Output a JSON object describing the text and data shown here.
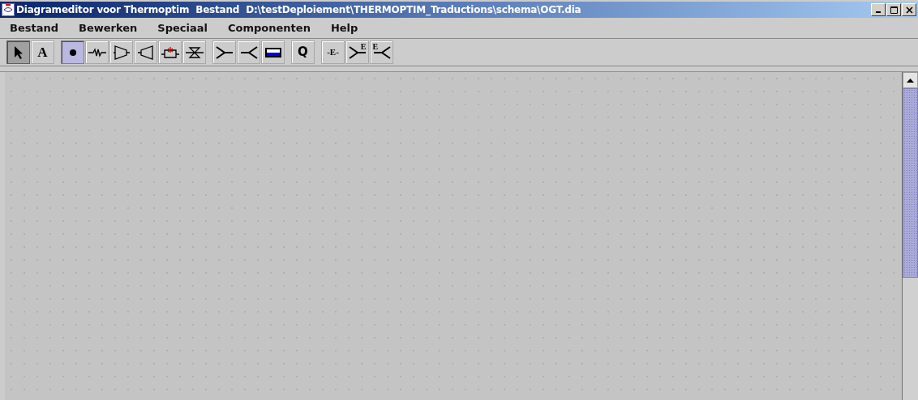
{
  "window": {
    "title": "Diagrameditor voor Thermoptim  Bestand  D:\\testDeploiement\\THERMOPTIM_Traductions\\schema\\OGT.dia"
  },
  "menu": [
    "Bestand",
    "Bewerken",
    "Speciaal",
    "Componenten",
    "Help"
  ],
  "toolbar": [
    [
      {
        "kind": "pointer",
        "selected": true
      },
      {
        "kind": "text",
        "label": "A",
        "selected": false
      }
    ],
    [
      {
        "kind": "node",
        "selected": true
      },
      {
        "kind": "wave",
        "selected": false
      },
      {
        "kind": "compressor",
        "selected": false
      },
      {
        "kind": "turbine",
        "selected": false
      },
      {
        "kind": "combustion",
        "selected": false
      },
      {
        "kind": "valve",
        "selected": false
      }
    ],
    [
      {
        "kind": "mixer",
        "selected": false
      },
      {
        "kind": "divider",
        "selected": false
      },
      {
        "kind": "exchanger",
        "selected": false
      }
    ],
    [
      {
        "kind": "letter",
        "label": "Q",
        "selected": false
      }
    ],
    [
      {
        "kind": "letter",
        "label": "-E-",
        "selected": false
      },
      {
        "kind": "mixer",
        "label": "E",
        "selected": false
      },
      {
        "kind": "divider",
        "label": "E",
        "selected": false
      }
    ]
  ]
}
